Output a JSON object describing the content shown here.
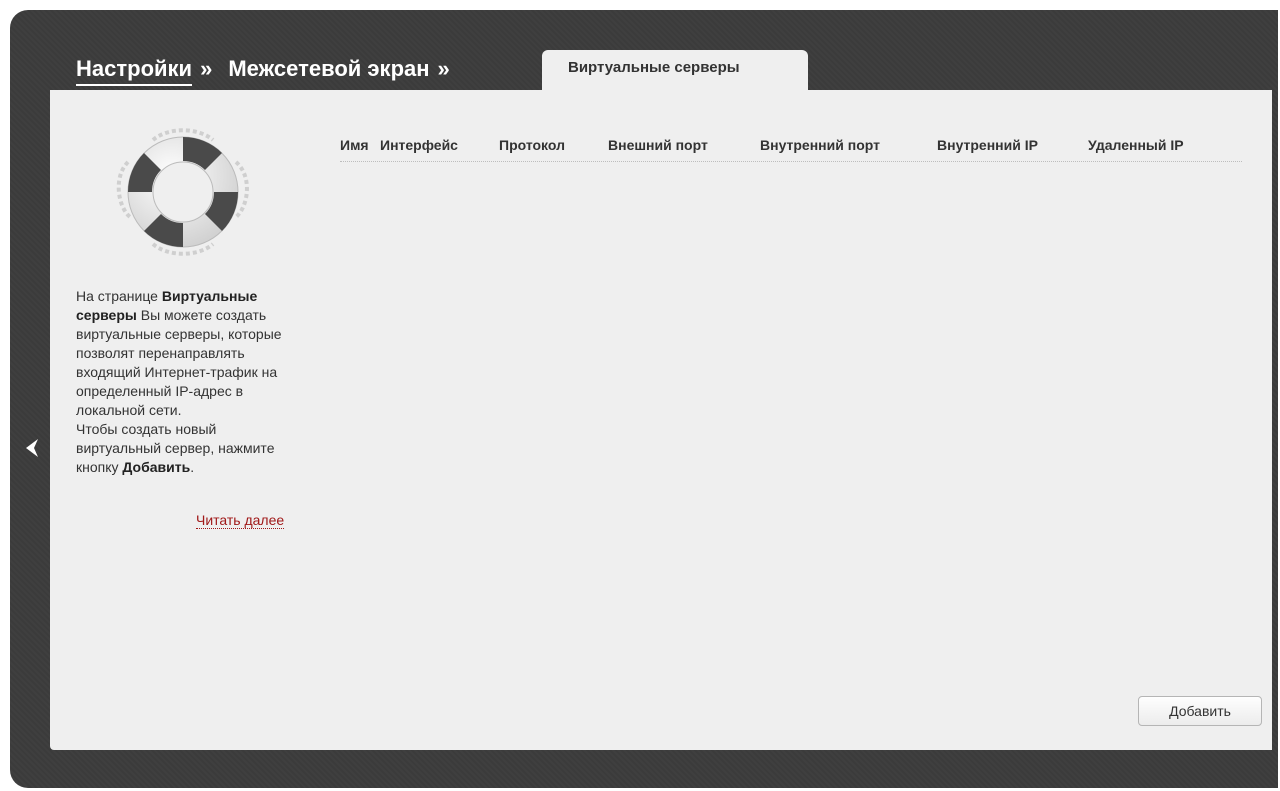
{
  "breadcrumb": {
    "items": [
      "Настройки",
      "Межсетевой экран"
    ],
    "separator": "»"
  },
  "tab": {
    "label": "Виртуальные серверы"
  },
  "help": {
    "text_1": "На странице ",
    "bold_1": "Виртуальные серверы",
    "text_2": " Вы можете создать виртуальные серверы, которые позволят перенаправлять входящий Интернет-трафик на определенный IP-адрес в локальной сети.",
    "text_3": "Чтобы создать новый виртуальный сервер, нажмите кнопку ",
    "bold_2": "Добавить",
    "text_4": ".",
    "read_more": "Читать далее"
  },
  "table": {
    "columns": [
      "Имя",
      "Интерфейс",
      "Протокол",
      "Внешний порт",
      "Внутренний порт",
      "Внутренний IP",
      "Удаленный IP"
    ],
    "rows": []
  },
  "buttons": {
    "add_label": "Добавить"
  },
  "icons": {
    "help": "lifebuoy-icon",
    "back": "chevron-left-icon"
  }
}
